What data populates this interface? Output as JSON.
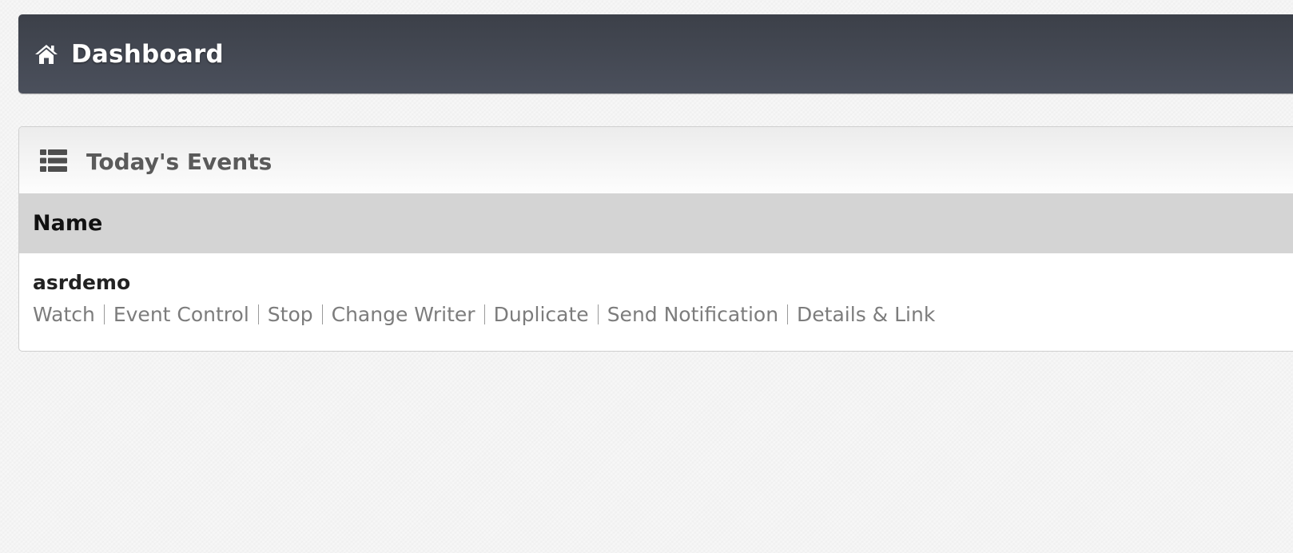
{
  "header": {
    "title": "Dashboard",
    "icon": "home-icon"
  },
  "events_panel": {
    "title": "Today's Events",
    "icon": "list-icon",
    "columns": [
      "Name"
    ],
    "rows": [
      {
        "name": "asrdemo",
        "actions": [
          "Watch",
          "Event Control",
          "Stop",
          "Change Writer",
          "Duplicate",
          "Send Notification",
          "Details & Link"
        ]
      }
    ]
  },
  "colors": {
    "header_bg_top": "#3c4049",
    "header_bg_bottom": "#4b505c",
    "table_header_bg": "#d4d4d4",
    "action_text": "#7c7c7c"
  }
}
